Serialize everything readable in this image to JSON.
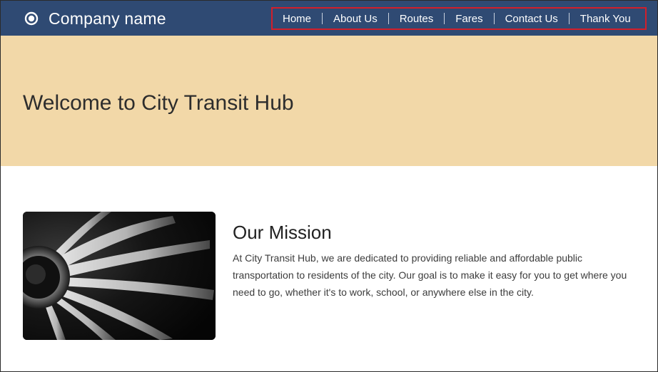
{
  "header": {
    "brand_name": "Company name",
    "brand_icon": "circle-logo-icon",
    "nav": [
      {
        "label": "Home"
      },
      {
        "label": "About Us"
      },
      {
        "label": "Routes"
      },
      {
        "label": "Fares"
      },
      {
        "label": "Contact Us"
      },
      {
        "label": "Thank You"
      }
    ],
    "nav_highlight_color": "#d21f2a"
  },
  "hero": {
    "title": "Welcome to City Transit Hub",
    "background": "#f2d8a8"
  },
  "mission": {
    "title": "Our Mission",
    "text": "At City Transit Hub, we are dedicated to providing reliable and affordable public transportation to residents of the city. Our goal is to make it easy for you to get where you need to go, whether it's to work, school, or anywhere else in the city.",
    "image_subject": "jet-engine-fan-blades"
  },
  "colors": {
    "header": "#2f4a73",
    "text": "#2d2d2d"
  }
}
